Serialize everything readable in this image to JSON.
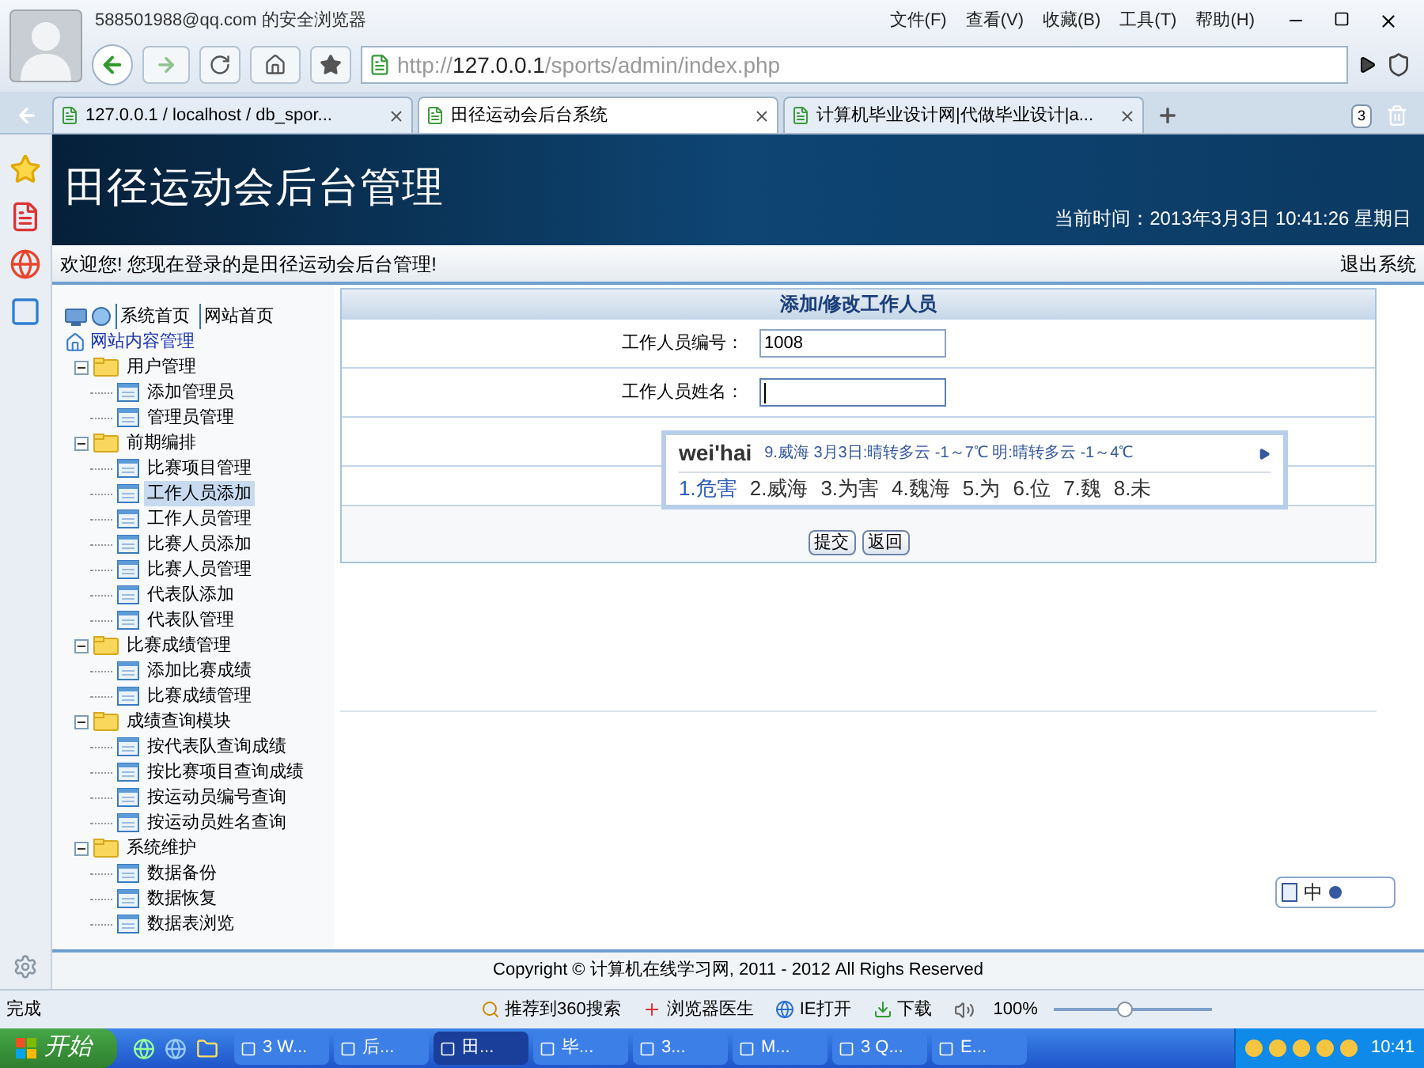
{
  "browser": {
    "user": "588501988@qq.com 的安全浏览器",
    "menu": [
      "文件(F)",
      "查看(V)",
      "收藏(B)",
      "工具(T)",
      "帮助(H)"
    ],
    "url_host": "http://127.0.0.1",
    "url_path": "/sports/admin/index.php",
    "tabs": [
      {
        "label": "127.0.0.1 / localhost / db_spor...",
        "selected": false
      },
      {
        "label": "田径运动会后台系统",
        "selected": true
      },
      {
        "label": "计算机毕业设计网|代做毕业设计|a...",
        "selected": false
      }
    ],
    "tab_count": "3"
  },
  "header": {
    "title": "田径运动会后台管理",
    "time": "当前时间：2013年3月3日  10:41:26 星期日"
  },
  "welcome": {
    "text": "欢迎您! 您现在登录的是田径运动会后台管理!",
    "logout": "退出系统"
  },
  "sidebar": {
    "links": [
      "系统首页",
      "网站首页"
    ],
    "root": "网站内容管理",
    "groups": [
      {
        "label": "用户管理",
        "expanded": true,
        "children": [
          {
            "label": "添加管理员",
            "selected": false
          },
          {
            "label": "管理员管理",
            "selected": false
          }
        ]
      },
      {
        "label": "前期编排",
        "expanded": true,
        "children": [
          {
            "label": "比赛项目管理",
            "selected": false
          },
          {
            "label": "工作人员添加",
            "selected": true
          },
          {
            "label": "工作人员管理",
            "selected": false
          },
          {
            "label": "比赛人员添加",
            "selected": false
          },
          {
            "label": "比赛人员管理",
            "selected": false
          },
          {
            "label": "代表队添加",
            "selected": false
          },
          {
            "label": "代表队管理",
            "selected": false
          }
        ]
      },
      {
        "label": "比赛成绩管理",
        "expanded": true,
        "children": [
          {
            "label": "添加比赛成绩",
            "selected": false
          },
          {
            "label": "比赛成绩管理",
            "selected": false
          }
        ]
      },
      {
        "label": "成绩查询模块",
        "expanded": true,
        "children": [
          {
            "label": "按代表队查询成绩",
            "selected": false
          },
          {
            "label": "按比赛项目查询成绩",
            "selected": false
          },
          {
            "label": "按运动员编号查询",
            "selected": false
          },
          {
            "label": "按运动员姓名查询",
            "selected": false
          }
        ]
      },
      {
        "label": "系统维护",
        "expanded": true,
        "children": [
          {
            "label": "数据备份",
            "selected": false
          },
          {
            "label": "数据恢复",
            "selected": false
          },
          {
            "label": "数据表浏览",
            "selected": false
          }
        ]
      }
    ]
  },
  "form": {
    "title": "添加/修改工作人员",
    "fields": [
      {
        "label": "工作人员编号：",
        "value": "1008",
        "focused": false
      },
      {
        "label": "工作人员姓名：",
        "focused": true
      }
    ],
    "buttons": [
      "提交",
      "返回"
    ]
  },
  "ime": {
    "input": "wei'hai",
    "hint": "9.威海  3月3日:晴转多云 -1～7℃  明:晴转多云 -1～4℃",
    "candidates": [
      {
        "label": "1.危害",
        "selected": true
      },
      {
        "label": "2.威海",
        "selected": false
      },
      {
        "label": "3.为害",
        "selected": false
      },
      {
        "label": "4.魏海",
        "selected": false
      },
      {
        "label": "5.为",
        "selected": false
      },
      {
        "label": "6.位",
        "selected": false
      },
      {
        "label": "7.魏",
        "selected": false
      },
      {
        "label": "8.未",
        "selected": false
      }
    ],
    "toolbar_mode": "中"
  },
  "footer": "Copyright © 计算机在线学习网, 2011 - 2012 All Righs Reserved",
  "status_bar": {
    "status": "完成",
    "items": [
      "推荐到360搜索",
      "浏览器医生",
      "IE打开",
      "下载"
    ],
    "zoom": "100%",
    "zoom_slider": {
      "level": 0.45
    }
  },
  "taskbar": {
    "start": "开始",
    "tasks": [
      {
        "label": "3 W...",
        "selected": false
      },
      {
        "label": "后...",
        "selected": false
      },
      {
        "label": "田...",
        "selected": true
      },
      {
        "label": "毕...",
        "selected": false
      },
      {
        "label": "3...",
        "selected": false
      },
      {
        "label": "M...",
        "selected": false
      },
      {
        "label": "3 Q...",
        "selected": false
      },
      {
        "label": "E...",
        "selected": false
      }
    ],
    "clock": "10:41"
  }
}
